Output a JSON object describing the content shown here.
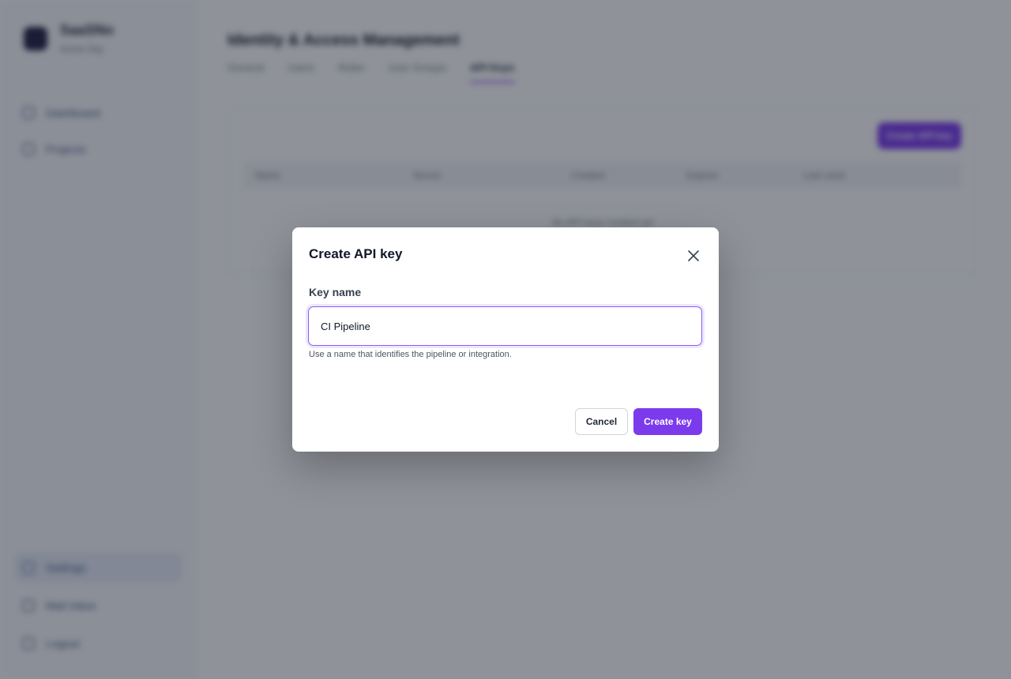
{
  "sidebar": {
    "brand_name": "SaaSNo",
    "brand_sub": "Acme Org",
    "nav_top": [
      {
        "label": "Dashboard",
        "icon": "dashboard-icon"
      },
      {
        "label": "Projects",
        "icon": "folder-icon"
      }
    ],
    "nav_bottom": [
      {
        "label": "Settings",
        "icon": "gear-icon",
        "active": true
      },
      {
        "label": "Mail Inbox",
        "icon": "inbox-icon"
      },
      {
        "label": "Logout",
        "icon": "logout-icon"
      }
    ]
  },
  "main": {
    "title": "Identity & Access Management",
    "tabs": [
      {
        "label": "General"
      },
      {
        "label": "Users"
      },
      {
        "label": "Roles"
      },
      {
        "label": "User Groups"
      },
      {
        "label": "API Keys",
        "active": true
      }
    ],
    "card": {
      "button_label": "Create API key",
      "columns": [
        "Name",
        "Secret",
        "Created",
        "Expires",
        "Last used"
      ],
      "empty_text": "No API keys created yet"
    }
  },
  "modal": {
    "title": "Create API key",
    "field_label": "Key name",
    "field_value": "CI Pipeline",
    "hint": "Use a name that identifies the pipeline or integration.",
    "cancel_label": "Cancel",
    "submit_label": "Create key"
  },
  "colors": {
    "accent": "#7c3aed",
    "overlay": "rgba(17, 24, 39, 0.47)"
  }
}
